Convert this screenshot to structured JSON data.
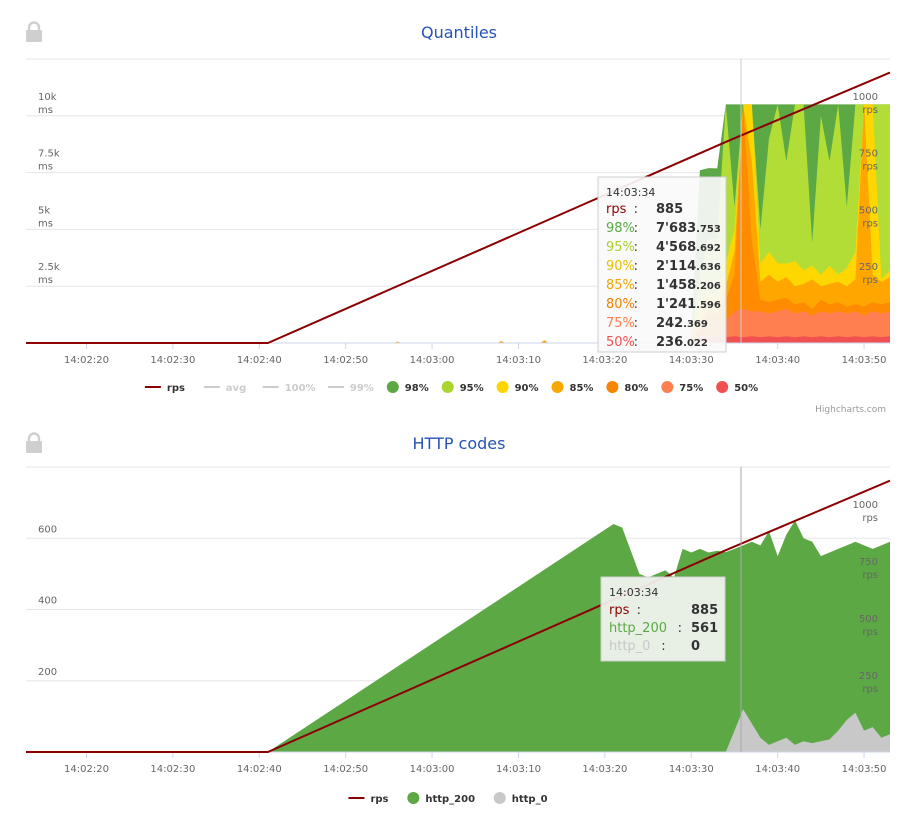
{
  "charts": {
    "quantiles": {
      "title": "Quantiles",
      "tooltip": {
        "time": "14:03:34",
        "rows": [
          {
            "label": "rps",
            "sep": ":",
            "int": "885",
            "dec": "",
            "color": "#8b0000"
          },
          {
            "label": "98%",
            "sep": ":",
            "int": "7'683",
            "dec": ".753",
            "color": "#5ca845"
          },
          {
            "label": "95%",
            "sep": ":",
            "int": "4'568",
            "dec": ".692",
            "color": "#a8cf2e"
          },
          {
            "label": "90%",
            "sep": ":",
            "int": "2'114",
            "dec": ".636",
            "color": "#e6c000"
          },
          {
            "label": "85%",
            "sep": ":",
            "int": "1'458",
            "dec": ".206",
            "color": "#f0a500"
          },
          {
            "label": "80%",
            "sep": ":",
            "int": "1'241",
            "dec": ".596",
            "color": "#f08000"
          },
          {
            "label": "75%",
            "sep": ":",
            "int": "242",
            "dec": ".369",
            "color": "#ff7c4c"
          },
          {
            "label": "50%",
            "sep": ":",
            "int": "236",
            "dec": ".022",
            "color": "#f05050"
          }
        ]
      },
      "legend": [
        {
          "label": "rps",
          "type": "line",
          "color": "#8b0000",
          "dim": false
        },
        {
          "label": "avg",
          "type": "line",
          "color": "#cccccc",
          "dim": true
        },
        {
          "label": "100%",
          "type": "line",
          "color": "#cccccc",
          "dim": true
        },
        {
          "label": "99%",
          "type": "line",
          "color": "#cccccc",
          "dim": true
        },
        {
          "label": "98%",
          "type": "dot",
          "color": "#5ca845",
          "dim": false
        },
        {
          "label": "95%",
          "type": "dot",
          "color": "#a8d62e",
          "dim": false
        },
        {
          "label": "90%",
          "type": "dot",
          "color": "#ffd500",
          "dim": false
        },
        {
          "label": "85%",
          "type": "dot",
          "color": "#f8a800",
          "dim": false
        },
        {
          "label": "80%",
          "type": "dot",
          "color": "#f88400",
          "dim": false
        },
        {
          "label": "75%",
          "type": "dot",
          "color": "#ff7f50",
          "dim": false
        },
        {
          "label": "50%",
          "type": "dot",
          "color": "#f05050",
          "dim": false
        }
      ],
      "credits": "Highcharts.com"
    },
    "http": {
      "title": "HTTP codes",
      "tooltip": {
        "time": "14:03:34",
        "rows": [
          {
            "label": "rps",
            "sep": ":",
            "int": "885",
            "dec": "",
            "color": "#8b0000"
          },
          {
            "label": "http_200",
            "sep": ":",
            "int": "561",
            "dec": "",
            "color": "#5ca845"
          },
          {
            "label": "http_0",
            "sep": ":",
            "int": "0",
            "dec": "",
            "color": "#c8c8c8"
          }
        ]
      },
      "legend": [
        {
          "label": "rps",
          "type": "line",
          "color": "#8b0000",
          "dim": false
        },
        {
          "label": "http_200",
          "type": "dot",
          "color": "#5ca845",
          "dim": false
        },
        {
          "label": "http_0",
          "type": "dot",
          "color": "#c8c8c8",
          "dim": false
        }
      ]
    }
  },
  "chart_data": [
    {
      "type": "area",
      "title": "Quantiles",
      "x_ticks": [
        "14:02:20",
        "14:02:30",
        "14:02:40",
        "14:02:50",
        "14:03:00",
        "14:03:10",
        "14:03:20",
        "14:03:30",
        "14:03:40",
        "14:03:50"
      ],
      "x_range_seconds": [
        "14:02:13",
        "14:03:53"
      ],
      "y_left": {
        "ticks": [
          2500,
          5000,
          7500,
          10000
        ],
        "tick_labels": [
          "2.5k",
          "5k",
          "7.5k",
          "10k"
        ],
        "unit": "ms",
        "range": [
          0,
          12500
        ]
      },
      "y_right": {
        "ticks": [
          250,
          500,
          750,
          1000
        ],
        "unit": "rps",
        "range": [
          0,
          1250
        ]
      },
      "crosshair": "14:03:34",
      "rps_line": {
        "name": "rps",
        "color": "#8b0000",
        "points": [
          [
            "14:02:13",
            0
          ],
          [
            "14:02:41",
            0
          ],
          [
            "14:03:34",
            885
          ],
          [
            "14:03:53",
            1190
          ]
        ]
      },
      "quantile_times": [
        "14:03:30",
        "14:03:31",
        "14:03:32",
        "14:03:33",
        "14:03:34",
        "14:03:35",
        "14:03:36",
        "14:03:37",
        "14:03:38",
        "14:03:39",
        "14:03:40",
        "14:03:41",
        "14:03:42",
        "14:03:43",
        "14:03:44",
        "14:03:45",
        "14:03:46",
        "14:03:47",
        "14:03:48",
        "14:03:49",
        "14:03:50",
        "14:03:51",
        "14:03:52",
        "14:03:53"
      ],
      "series": [
        {
          "name": "98%",
          "color": "#5ca845",
          "values": [
            500,
            7600,
            7700,
            7683,
            10500,
            10500,
            10500,
            10500,
            10500,
            10500,
            10500,
            10500,
            10500,
            10500,
            10500,
            10500,
            10500,
            10500,
            10500,
            10500,
            10500,
            10500,
            10500,
            10500
          ]
        },
        {
          "name": "95%",
          "color": "#b2dc36",
          "values": [
            400,
            3000,
            4600,
            4568,
            10500,
            6000,
            10500,
            10500,
            5000,
            9000,
            10500,
            8000,
            10500,
            10500,
            4400,
            10000,
            8000,
            10500,
            6000,
            10500,
            10500,
            10500,
            10500,
            10500
          ]
        },
        {
          "name": "90%",
          "color": "#ffd700",
          "values": [
            300,
            1600,
            2200,
            2114,
            3500,
            5000,
            10500,
            10500,
            3500,
            4000,
            3500,
            3500,
            3600,
            3200,
            3400,
            3000,
            3400,
            3000,
            3300,
            4000,
            10500,
            10500,
            2800,
            3200
          ]
        },
        {
          "name": "85%",
          "color": "#ffa700",
          "values": [
            250,
            1000,
            1500,
            1458,
            2500,
            4000,
            10500,
            8000,
            2700,
            3000,
            2700,
            2900,
            2500,
            2600,
            2800,
            2500,
            2600,
            2700,
            2500,
            2800,
            10500,
            3000,
            2700,
            2900
          ]
        },
        {
          "name": "80%",
          "color": "#ff8c00",
          "values": [
            200,
            600,
            1300,
            1241,
            1900,
            3000,
            10500,
            4500,
            1900,
            1800,
            1900,
            2000,
            1700,
            1800,
            1500,
            1900,
            1700,
            1800,
            1600,
            1700,
            1600,
            1800,
            1700,
            1800
          ]
        },
        {
          "name": "75%",
          "color": "#ff7f50",
          "values": [
            150,
            300,
            400,
            242,
            1000,
            1400,
            1500,
            1400,
            1400,
            1300,
            1400,
            1500,
            1300,
            1400,
            1200,
            1400,
            1300,
            1400,
            1300,
            1400,
            1200,
            1400,
            1300,
            1400
          ]
        },
        {
          "name": "50%",
          "color": "#f05050",
          "values": [
            100,
            200,
            250,
            236,
            250,
            300,
            250,
            300,
            250,
            300,
            250,
            300,
            250,
            300,
            250,
            300,
            250,
            300,
            250,
            300,
            250,
            300,
            250,
            300
          ]
        }
      ],
      "tooltip_values": {
        "rps": 885,
        "98%": 7683.753,
        "95%": 4568.692,
        "90%": 2114.636,
        "85%": 1458.206,
        "80%": 1241.596,
        "75%": 242.369,
        "50%": 236.022
      }
    },
    {
      "type": "area",
      "title": "HTTP codes",
      "x_ticks": [
        "14:02:20",
        "14:02:30",
        "14:02:40",
        "14:02:50",
        "14:03:00",
        "14:03:10",
        "14:03:20",
        "14:03:30",
        "14:03:40",
        "14:03:50"
      ],
      "x_range_seconds": [
        "14:02:13",
        "14:03:53"
      ],
      "y_left": {
        "ticks": [
          200,
          400,
          600
        ],
        "range": [
          0,
          800
        ]
      },
      "y_right": {
        "ticks": [
          250,
          500,
          750,
          1000
        ],
        "unit": "rps",
        "range": [
          0,
          1250
        ]
      },
      "crosshair": "14:03:34",
      "series": [
        {
          "name": "http_200",
          "color": "#5ca845",
          "points": [
            [
              "14:02:13",
              0
            ],
            [
              "14:02:41",
              0
            ],
            [
              "14:03:21",
              640
            ],
            [
              "14:03:22",
              630
            ],
            [
              "14:03:24",
              500
            ],
            [
              "14:03:25",
              490
            ],
            [
              "14:03:27",
              510
            ],
            [
              "14:03:28",
              490
            ],
            [
              "14:03:29",
              570
            ],
            [
              "14:03:30",
              560
            ],
            [
              "14:03:31",
              570
            ],
            [
              "14:03:32",
              560
            ],
            [
              "14:03:33",
              565
            ],
            [
              "14:03:34",
              561
            ],
            [
              "14:03:35",
              570
            ],
            [
              "14:03:36",
              580
            ],
            [
              "14:03:37",
              590
            ],
            [
              "14:03:38",
              580
            ],
            [
              "14:03:39",
              620
            ],
            [
              "14:03:40",
              550
            ],
            [
              "14:03:41",
              610
            ],
            [
              "14:03:42",
              650
            ],
            [
              "14:03:43",
              600
            ],
            [
              "14:03:44",
              590
            ],
            [
              "14:03:45",
              550
            ],
            [
              "14:03:46",
              560
            ],
            [
              "14:03:47",
              570
            ],
            [
              "14:03:48",
              580
            ],
            [
              "14:03:49",
              590
            ],
            [
              "14:03:50",
              580
            ],
            [
              "14:03:51",
              570
            ],
            [
              "14:03:52",
              580
            ],
            [
              "14:03:53",
              590
            ]
          ]
        },
        {
          "name": "http_0",
          "color": "#c8c8c8",
          "points": [
            [
              "14:03:34",
              0
            ],
            [
              "14:03:35",
              60
            ],
            [
              "14:03:36",
              120
            ],
            [
              "14:03:37",
              80
            ],
            [
              "14:03:38",
              40
            ],
            [
              "14:03:39",
              20
            ],
            [
              "14:03:40",
              30
            ],
            [
              "14:03:41",
              40
            ],
            [
              "14:03:42",
              20
            ],
            [
              "14:03:43",
              30
            ],
            [
              "14:03:44",
              25
            ],
            [
              "14:03:45",
              30
            ],
            [
              "14:03:46",
              35
            ],
            [
              "14:03:47",
              60
            ],
            [
              "14:03:48",
              90
            ],
            [
              "14:03:49",
              110
            ],
            [
              "14:03:50",
              60
            ],
            [
              "14:03:51",
              70
            ],
            [
              "14:03:52",
              40
            ],
            [
              "14:03:53",
              50
            ]
          ]
        },
        {
          "name": "rps",
          "color": "#8b0000",
          "points": [
            [
              "14:02:13",
              0
            ],
            [
              "14:02:41",
              0
            ],
            [
              "14:03:34",
              885
            ],
            [
              "14:03:53",
              1190
            ]
          ]
        }
      ],
      "tooltip_values": {
        "rps": 885,
        "http_200": 561,
        "http_0": 0
      }
    }
  ]
}
